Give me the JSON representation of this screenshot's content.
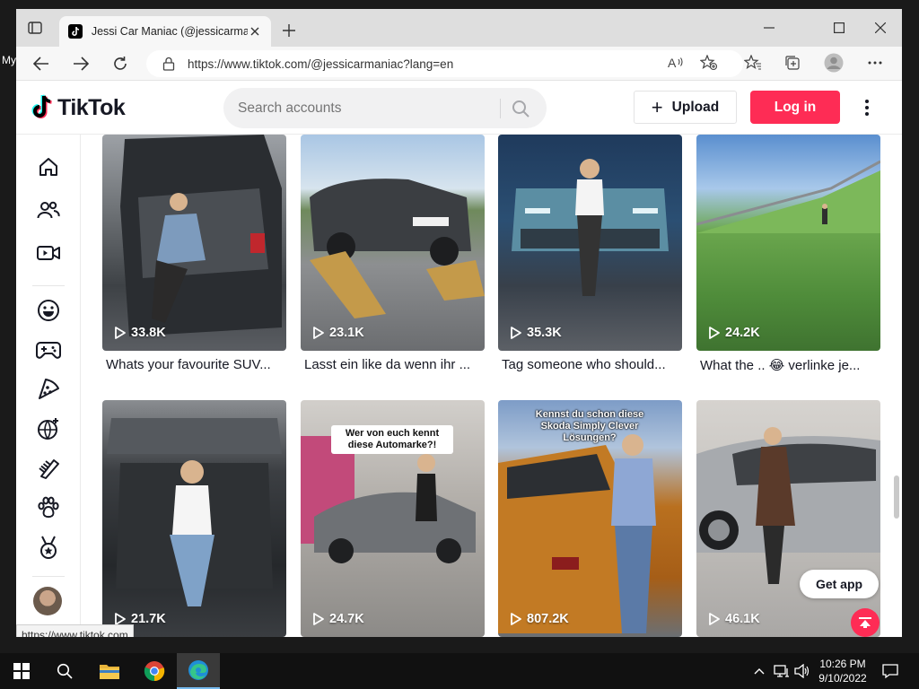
{
  "desktop": {
    "label": "My"
  },
  "browser": {
    "tab_title": "Jessi Car Maniac (@jessicarmaniac",
    "url": "https://www.tiktok.com/@jessicarmaniac?lang=en",
    "status_link": "https://www.tiktok.com"
  },
  "header": {
    "logo_text": "TikTok",
    "search_placeholder": "Search accounts",
    "upload_label": "Upload",
    "login_label": "Log in"
  },
  "sidebar": {
    "icons": [
      "home-icon",
      "following-icon",
      "live-icon",
      "comedy-icon",
      "gaming-icon",
      "food-icon",
      "science-icon",
      "beauty-icon",
      "animals-icon",
      "sports-icon"
    ]
  },
  "videos": [
    {
      "views": "33.8K",
      "caption": "Whats your favourite SUV..."
    },
    {
      "views": "23.1K",
      "caption": "Lasst ein like da wenn ihr ..."
    },
    {
      "views": "35.3K",
      "caption": "Tag someone who should..."
    },
    {
      "views": "24.2K",
      "caption": "What the .. 😂 verlinke je..."
    },
    {
      "views": "21.7K",
      "caption": ""
    },
    {
      "views": "24.7K",
      "caption": "",
      "overlay": "Wer von euch kennt diese Automarke?!"
    },
    {
      "views": "807.2K",
      "caption": "",
      "overlay": "Kennst du schon diese Skoda Simply Clever Lösungen?"
    },
    {
      "views": "46.1K",
      "caption": ""
    }
  ],
  "floating": {
    "get_app_label": "Get app"
  },
  "taskbar": {
    "time": "10:26 PM",
    "date": "9/10/2022"
  },
  "colors": {
    "brand_red": "#fe2c55",
    "text": "#161823"
  }
}
